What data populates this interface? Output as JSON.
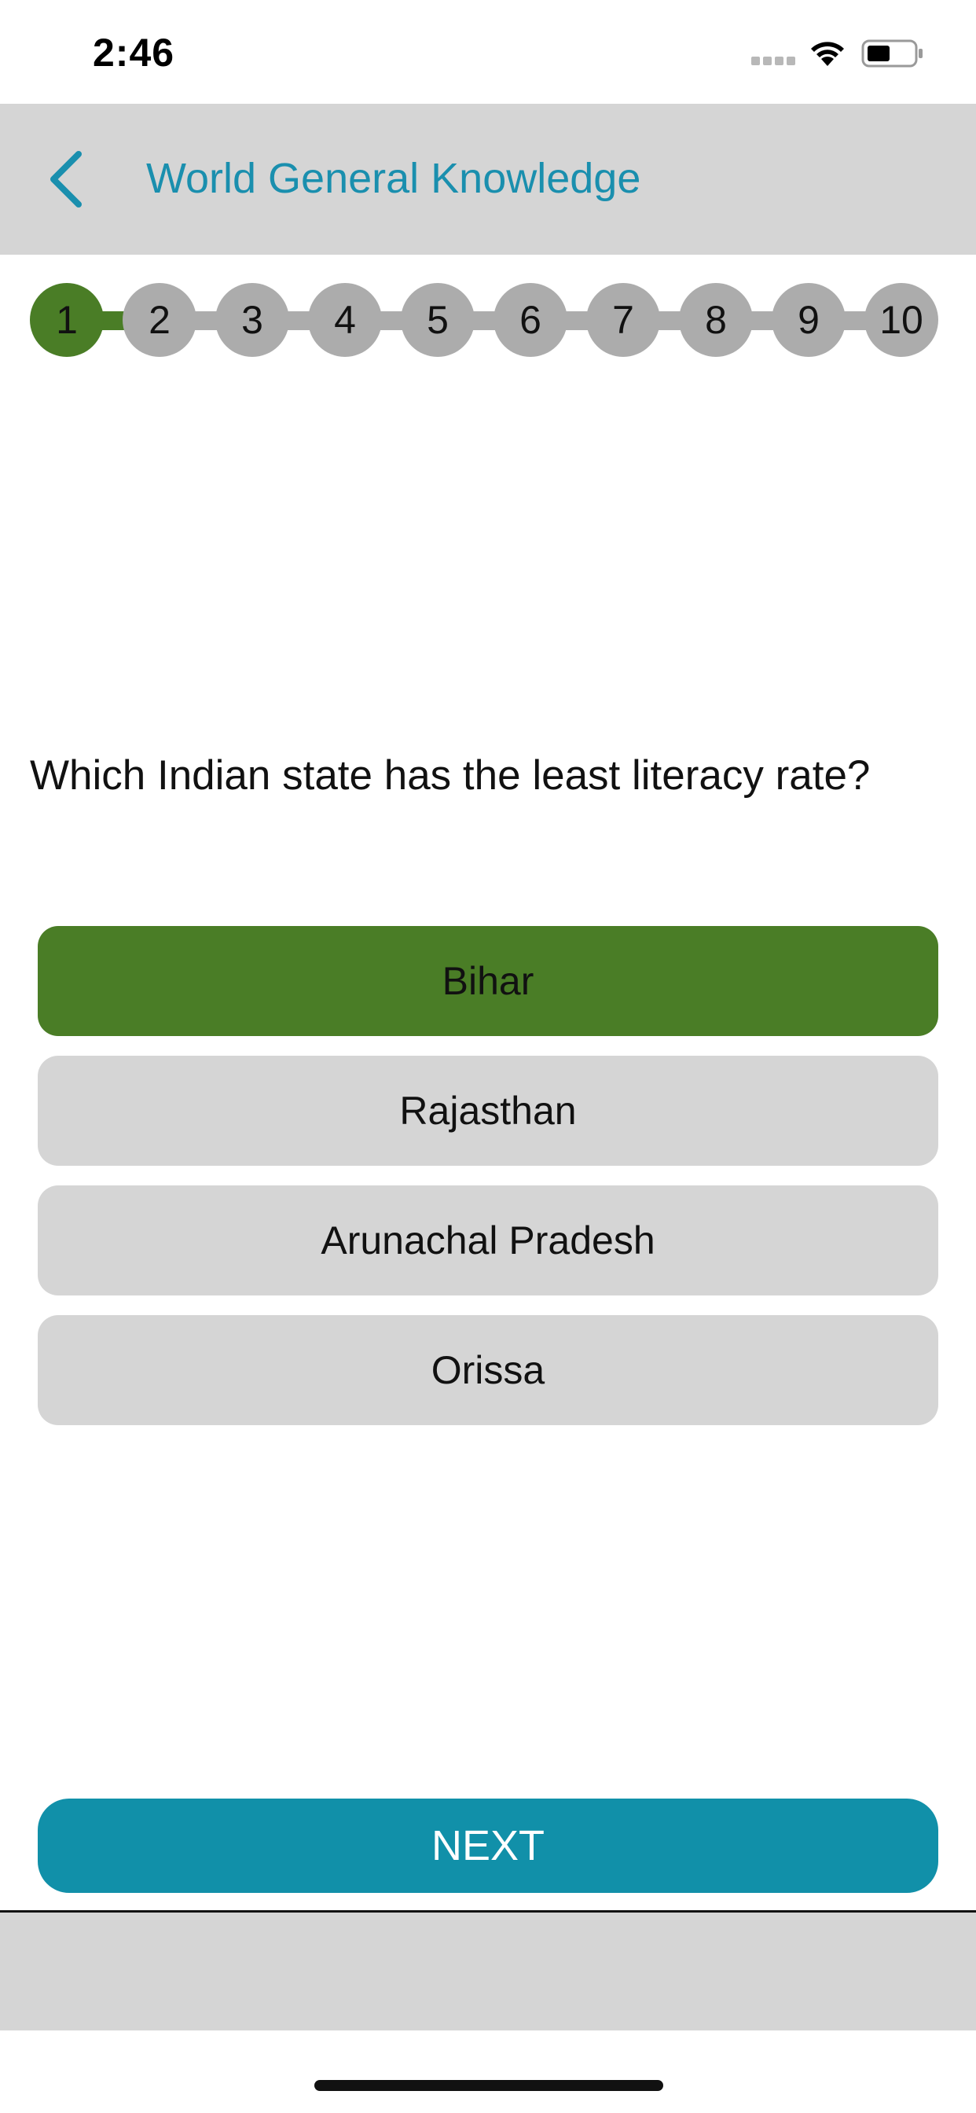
{
  "status_bar": {
    "time": "2:46"
  },
  "nav": {
    "title": "World General Knowledge",
    "back_icon": "chevron-left-icon",
    "accent_color": "#1a8fae"
  },
  "progress": {
    "current": 1,
    "steps": [
      "1",
      "2",
      "3",
      "4",
      "5",
      "6",
      "7",
      "8",
      "9",
      "10"
    ],
    "active_color": "#4a7d26",
    "inactive_color": "#acacac"
  },
  "question": {
    "text": "Which Indian state has the least literacy rate?"
  },
  "answers": [
    {
      "label": "Bihar",
      "selected": true
    },
    {
      "label": "Rajasthan",
      "selected": false
    },
    {
      "label": "Arunachal Pradesh",
      "selected": false
    },
    {
      "label": "Orissa",
      "selected": false
    }
  ],
  "next_button": {
    "label": "NEXT",
    "color": "#1190a9"
  }
}
